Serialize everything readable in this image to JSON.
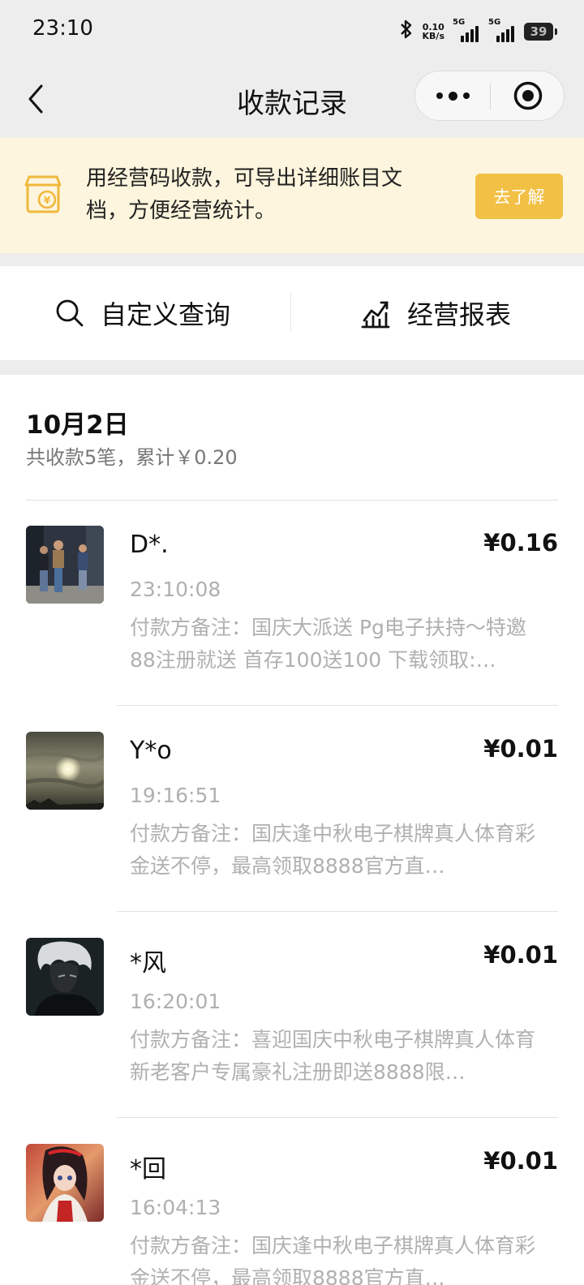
{
  "status_bar": {
    "time": "23:10",
    "net_speed_value": "0.10",
    "net_speed_unit": "KB/s",
    "signal_1": "5G",
    "signal_2": "5G",
    "battery": "39"
  },
  "nav": {
    "title": "收款记录"
  },
  "banner": {
    "text": "用经营码收款，可导出详细账目文档，方便经营统计。",
    "button_label": "去了解",
    "accent_color": "#f2c045"
  },
  "toolbar": {
    "custom_query_label": "自定义查询",
    "report_label": "经营报表"
  },
  "day_group": {
    "date": "10月2日",
    "summary": "共收款5笔，累计￥0.20"
  },
  "records": [
    {
      "name": "D*.",
      "amount": "¥0.16",
      "time": "23:10:08",
      "note": "付款方备注：国庆大派送 Pg电子扶持～特邀88注册就送 首存100送100 下载领取:…"
    },
    {
      "name": "Y*o",
      "amount": "¥0.01",
      "time": "19:16:51",
      "note": "付款方备注：国庆逢中秋电子棋牌真人体育彩金送不停，最高领取8888官方直…"
    },
    {
      "name": "*风",
      "amount": "¥0.01",
      "time": "16:20:01",
      "note": "付款方备注：喜迎国庆中秋电子棋牌真人体育新老客户专属豪礼注册即送8888限…"
    },
    {
      "name": "*回",
      "amount": "¥0.01",
      "time": "16:04:13",
      "note": "付款方备注：国庆逢中秋电子棋牌真人体育彩金送不停，最高领取8888官方直…"
    }
  ]
}
